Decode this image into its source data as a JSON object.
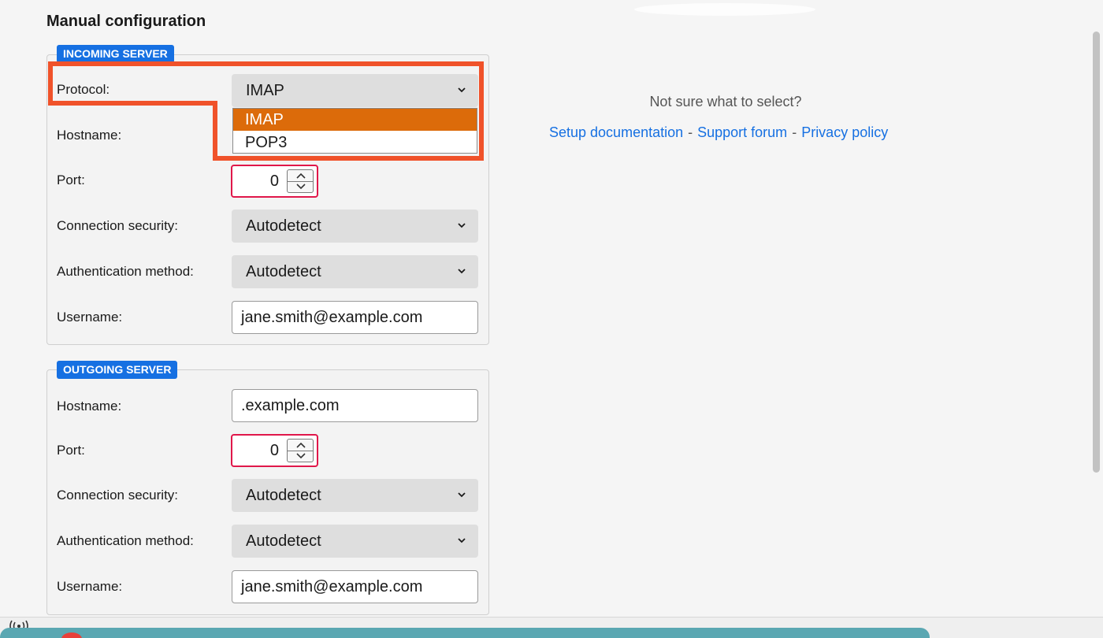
{
  "page": {
    "title": "Manual configuration"
  },
  "incoming": {
    "legend": "INCOMING SERVER",
    "protocol_label": "Protocol:",
    "protocol_value": "IMAP",
    "protocol_options": [
      "IMAP",
      "POP3"
    ],
    "hostname_label": "Hostname:",
    "port_label": "Port:",
    "port_value": "0",
    "security_label": "Connection security:",
    "security_value": "Autodetect",
    "auth_label": "Authentication method:",
    "auth_value": "Autodetect",
    "username_label": "Username:",
    "username_value": "jane.smith@example.com"
  },
  "outgoing": {
    "legend": "OUTGOING SERVER",
    "hostname_label": "Hostname:",
    "hostname_value": ".example.com",
    "port_label": "Port:",
    "port_value": "0",
    "security_label": "Connection security:",
    "security_value": "Autodetect",
    "auth_label": "Authentication method:",
    "auth_value": "Autodetect",
    "username_label": "Username:",
    "username_value": "jane.smith@example.com"
  },
  "help": {
    "question": "Not sure what to select?",
    "links": [
      "Setup documentation",
      "Support forum",
      "Privacy policy"
    ],
    "separator": "-"
  },
  "colors": {
    "accent": "#1670e2",
    "selected_option": "#dc6b0a",
    "annotation": "#f0522a",
    "invalid_border": "#e0174a"
  },
  "icons": {
    "dropdown": "chevron-down-icon",
    "spinner_up": "chevron-up-icon",
    "spinner_down": "chevron-down-icon",
    "status": "signal-icon"
  }
}
